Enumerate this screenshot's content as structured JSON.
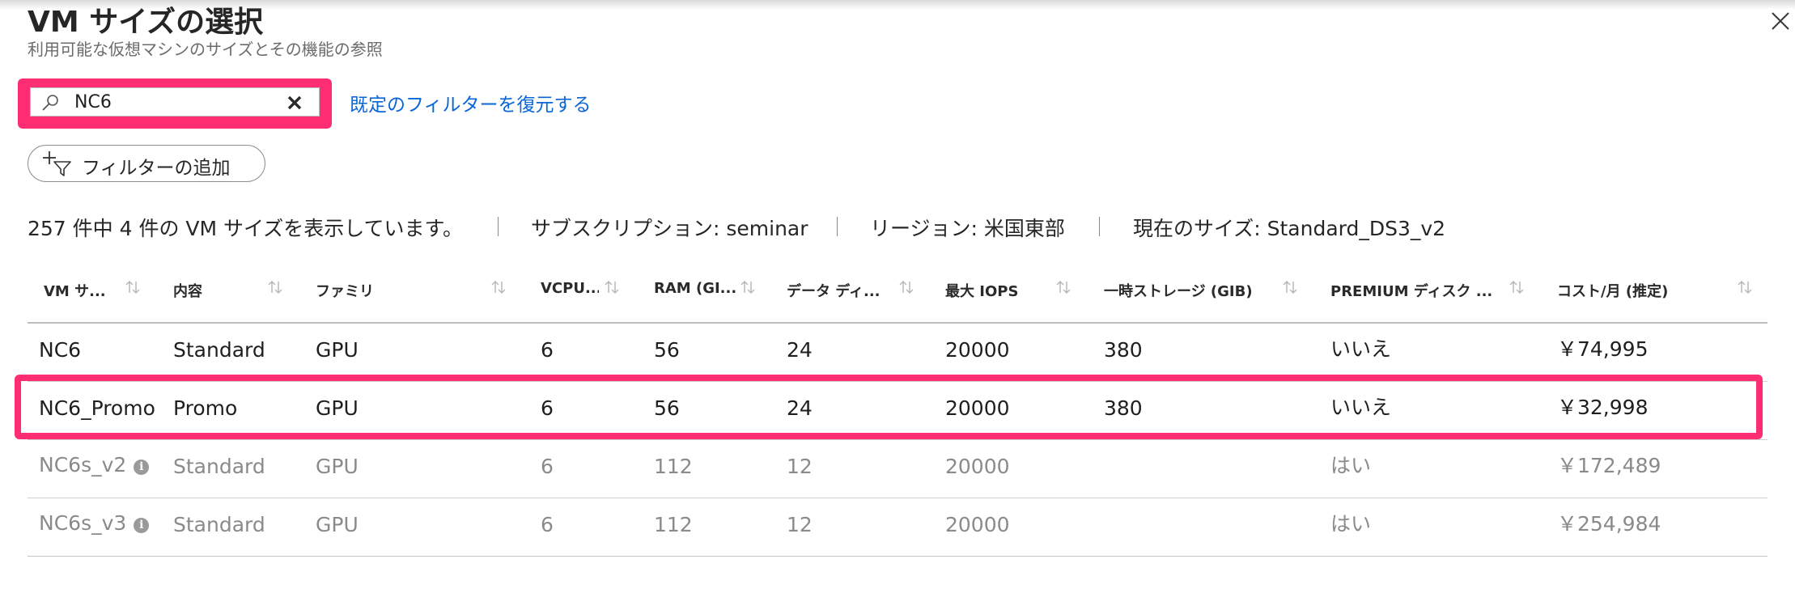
{
  "header": {
    "title": "VM サイズの選択",
    "subtitle": "利用可能な仮想マシンのサイズとその機能の参照"
  },
  "search": {
    "value": "NC6",
    "placeholder": ""
  },
  "restore_filters_label": "既定のフィルターを復元する",
  "add_filter_label": "フィルターの追加",
  "info_bar": {
    "count_text": "257 件中 4 件の VM サイズを表示しています。",
    "subscription": "サブスクリプション: seminar",
    "region": "リージョン: 米国東部",
    "current_size": "現在のサイズ: Standard_DS3_v2"
  },
  "columns": [
    "VM サ...",
    "内容",
    "ファミリ",
    "VCPU...",
    "RAM (GI...",
    "データ ディ...",
    "最大 IOPS",
    "一時ストレージ (GIB)",
    "PREMIUM ディスク ...",
    "コスト/月 (推定)"
  ],
  "rows": [
    {
      "name": "NC6",
      "desc": "Standard",
      "family": "GPU",
      "vcpu": "6",
      "ram": "56",
      "data_disks": "24",
      "max_iops": "20000",
      "temp_storage": "380",
      "premium": "いいえ",
      "cost": "￥74,995",
      "available": true
    },
    {
      "name": "NC6_Promo",
      "desc": "Promo",
      "family": "GPU",
      "vcpu": "6",
      "ram": "56",
      "data_disks": "24",
      "max_iops": "20000",
      "temp_storage": "380",
      "premium": "いいえ",
      "cost": "￥32,998",
      "available": true
    },
    {
      "name": "NC6s_v2",
      "desc": "Standard",
      "family": "GPU",
      "vcpu": "6",
      "ram": "112",
      "data_disks": "12",
      "max_iops": "20000",
      "temp_storage": "",
      "premium": "はい",
      "cost": "￥172,489",
      "available": false
    },
    {
      "name": "NC6s_v3",
      "desc": "Standard",
      "family": "GPU",
      "vcpu": "6",
      "ram": "112",
      "data_disks": "12",
      "max_iops": "20000",
      "temp_storage": "",
      "premium": "はい",
      "cost": "￥254,984",
      "available": false
    }
  ],
  "icons": {
    "close": "close-icon",
    "search": "search-icon",
    "clear": "clear-search-icon",
    "add_filter": "add-filter-icon",
    "sort": "sort-arrows-icon",
    "info": "info-icon"
  },
  "colors": {
    "highlight": "#ff2e73",
    "link": "#0a66d6",
    "dimmed_text": "#8a8a8a"
  }
}
